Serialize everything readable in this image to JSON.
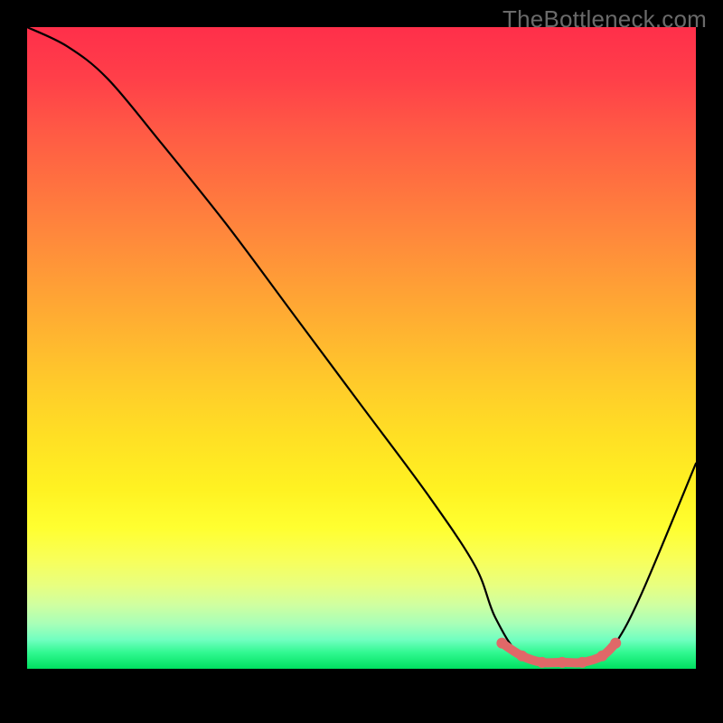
{
  "watermark": "TheBottleneck.com",
  "chart_data": {
    "type": "line",
    "title": "",
    "xlabel": "",
    "ylabel": "",
    "xlim": [
      0,
      100
    ],
    "ylim": [
      0,
      100
    ],
    "gradient_meaning": "vertical color scale: red at top (high bottleneck), green at bottom (low bottleneck)",
    "series": [
      {
        "name": "bottleneck-curve",
        "color": "#000000",
        "x": [
          0,
          6,
          12,
          20,
          30,
          40,
          50,
          60,
          67,
          70,
          74,
          80,
          85,
          88,
          92,
          100
        ],
        "values": [
          100,
          97,
          92,
          82,
          69,
          55,
          41,
          27,
          16,
          8,
          2,
          1,
          1,
          4,
          12,
          32
        ]
      },
      {
        "name": "optimal-range-marker",
        "color": "#e86b6b",
        "x": [
          71,
          74,
          77,
          80,
          83,
          86,
          88
        ],
        "values": [
          4,
          2,
          1,
          1,
          1,
          2,
          4
        ]
      }
    ]
  }
}
